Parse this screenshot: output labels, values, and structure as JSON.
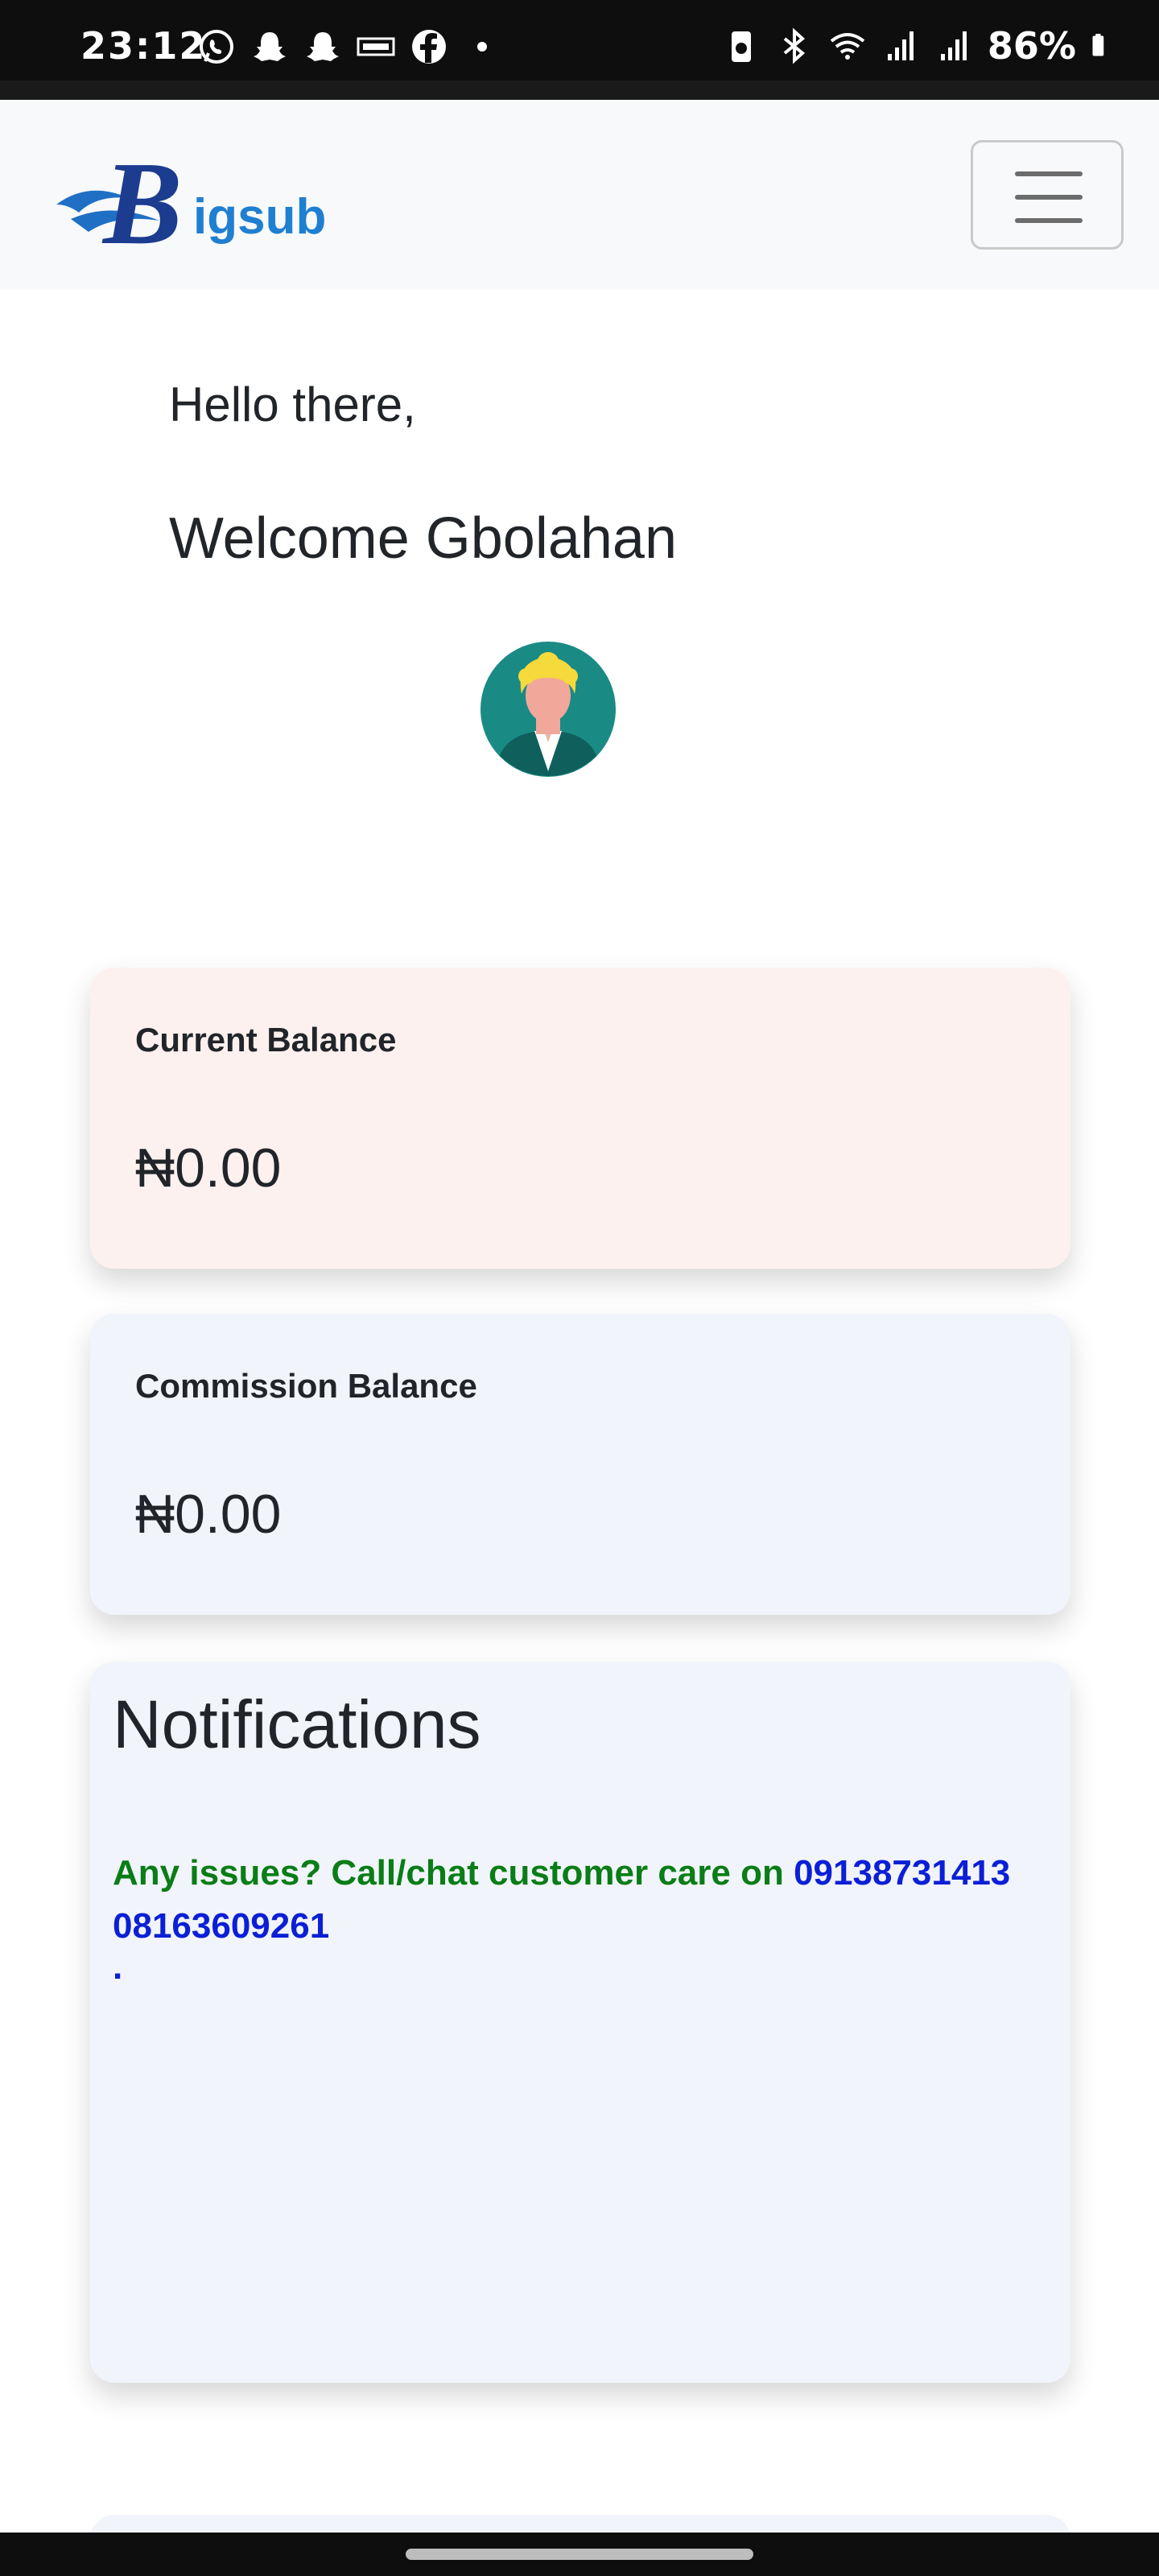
{
  "status_bar": {
    "time": "23:12",
    "left_icons": [
      "whatsapp-icon",
      "snapchat-icon",
      "snapchat-icon",
      "goal-app-icon",
      "facebook-icon",
      "dot-icon"
    ],
    "right_icons": [
      "battery-saver-icon",
      "bluetooth-icon",
      "wifi-icon",
      "signal-icon",
      "signal-icon"
    ],
    "battery": "86%"
  },
  "navbar": {
    "logo_text": "igsub",
    "logo_letter": "B",
    "menu_icon": "hamburger-menu-icon"
  },
  "greeting": {
    "hello": "Hello there,",
    "welcome": "Welcome Gbolahan"
  },
  "avatar_icon": "user-avatar-icon",
  "cards": {
    "current_balance": {
      "label": "Current Balance",
      "value": "₦0.00"
    },
    "commission_balance": {
      "label": "Commission Balance",
      "value": "₦0.00"
    }
  },
  "notifications": {
    "title": "Notifications",
    "message": "Any issues? Call/chat customer care on ",
    "phone1": "09138731413",
    "phone2": "08163609261",
    "dot": "."
  },
  "colors": {
    "brand": "#1f6fc4",
    "notif_green": "#0a7d16",
    "notif_blue": "#0b1fd6"
  }
}
